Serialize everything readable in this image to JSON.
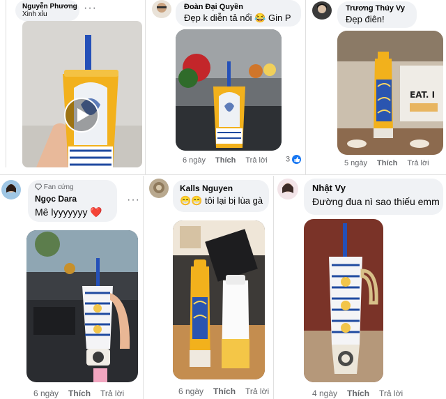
{
  "comments": [
    {
      "author": "Nguyễn Phương",
      "text": "Xinh xỉu",
      "time": "",
      "like": "",
      "reply": "",
      "reactions": ""
    },
    {
      "author": "Đoàn Đại Quyền",
      "text": "Đẹp k diễn tả nổi 😂 Gin P",
      "time": "6 ngày",
      "like": "Thích",
      "reply": "Trả lời",
      "reactions": "3"
    },
    {
      "author": "Trương Thúy Vy",
      "text": "Đẹp điên!",
      "time": "5 ngày",
      "like": "Thích",
      "reply": "Trả lời",
      "reactions": ""
    },
    {
      "author": "Ngọc Dara",
      "badge": "Fan cứng",
      "text": "Mê lyyyyyyy ❤️",
      "time": "6 ngày",
      "like": "Thích",
      "reply": "Trả lời",
      "reactions": ""
    },
    {
      "author": "Kalls Nguyen",
      "text": "😁😁 tôi lại bị lùa gà",
      "time": "6 ngày",
      "like": "Thích",
      "reply": "Trả lời",
      "reactions": ""
    },
    {
      "author": "Nhật Vy",
      "text": "Đường đua nì sao thiếu emm",
      "time": "4 ngày",
      "like": "Thích",
      "reply": "Trả lời",
      "reactions": ""
    }
  ],
  "more_menu": "···",
  "colors": {
    "bubble": "#f0f2f5",
    "meta": "#65676b",
    "reaction_blue": "#1877f2",
    "heart": "#f33e58",
    "cup_yellow": "#f2b11c",
    "cup_blue": "#1f4aa0"
  },
  "icons": {
    "play": "play-icon",
    "badge": "diamond-icon",
    "like": "like-icon",
    "more": "more-icon"
  }
}
